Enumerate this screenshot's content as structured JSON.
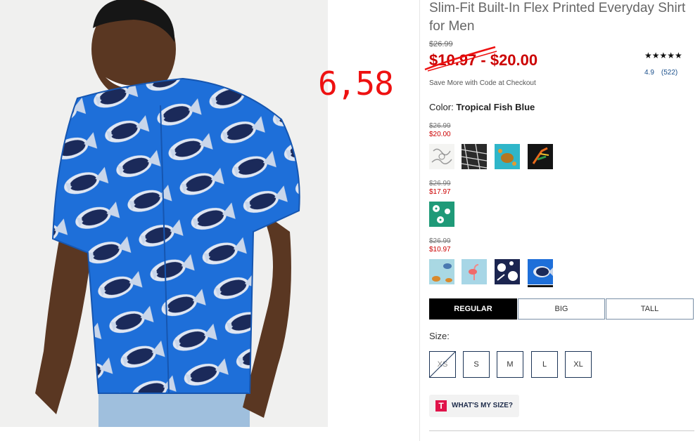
{
  "product": {
    "title": "Slim-Fit Built-In Flex Printed Everyday Shirt for Men",
    "price_was": "$26.99",
    "price_range": "$10.97 - $20.00",
    "promo": "Save More with Code at Checkout",
    "stars": "★★★★★",
    "rating": "4.9",
    "review_count": "(522)"
  },
  "annotation": "6,58",
  "color": {
    "label": "Color:",
    "selected": "Tropical Fish Blue"
  },
  "price_groups": [
    {
      "was": "$26.99",
      "now": "$20.00",
      "swatches": [
        "white-floral",
        "black-white-print",
        "turquoise-turtle",
        "black-bird-of-paradise"
      ]
    },
    {
      "was": "$26.99",
      "now": "$17.97",
      "swatches": [
        "green-hibiscus"
      ]
    },
    {
      "was": "$26.99",
      "now": "$10.97",
      "swatches": [
        "light-blue-fish",
        "flamingo",
        "navy-hibiscus",
        "tropical-fish-blue"
      ]
    }
  ],
  "fit_tabs": [
    {
      "label": "REGULAR",
      "active": true
    },
    {
      "label": "BIG",
      "active": false
    },
    {
      "label": "TALL",
      "active": false
    }
  ],
  "size": {
    "label": "Size:",
    "options": [
      {
        "label": "XS",
        "available": false
      },
      {
        "label": "S",
        "available": true
      },
      {
        "label": "M",
        "available": true
      },
      {
        "label": "L",
        "available": true
      },
      {
        "label": "XL",
        "available": true
      }
    ]
  },
  "my_size": {
    "logo": "T",
    "label": "WHAT'S MY SIZE?"
  },
  "colors": {
    "sale_red": "#cc0000",
    "shirt_blue": "#1e6fd9",
    "fish_navy": "#1b2a5a",
    "annotation_red": "#ee1111"
  }
}
